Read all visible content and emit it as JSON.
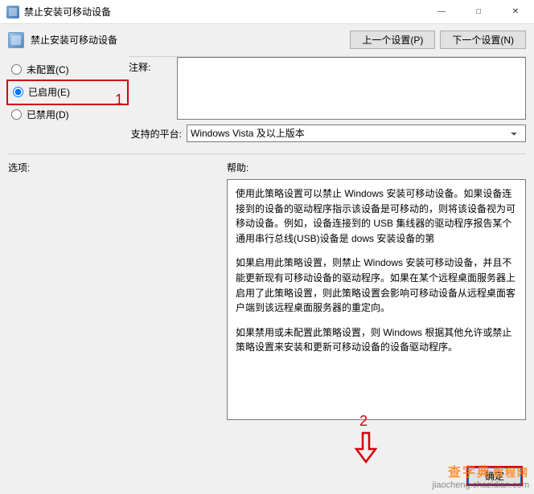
{
  "window": {
    "title": "禁止安装可移动设备",
    "minimize": "—",
    "maximize": "□",
    "close": "✕"
  },
  "header": {
    "policy_name": "禁止安装可移动设备",
    "prev_btn": "上一个设置(P)",
    "next_btn": "下一个设置(N)"
  },
  "state_radios": {
    "not_configured": "未配置(C)",
    "enabled": "已启用(E)",
    "disabled": "已禁用(D)",
    "selected": "enabled"
  },
  "annotations": {
    "one": "1",
    "two": "2"
  },
  "labels": {
    "comment": "注释:",
    "platform": "支持的平台:",
    "options": "选项:",
    "help": "帮助:"
  },
  "comment_value": "",
  "platform_value": "Windows Vista 及以上版本",
  "help_text": {
    "p1": "使用此策略设置可以禁止 Windows 安装可移动设备。如果设备连接到的设备的驱动程序指示该设备是可移动的，则将该设备视为可移动设备。例如，设备连接到的 USB 集线器的驱动程序报告某个通用串行总线(USB)设备是                                                                                      dows 安装设备的第",
    "p2": "如果启用此策略设置，则禁止 Windows 安装可移动设备，并且不能更新现有可移动设备的驱动程序。如果在某个远程桌面服务器上启用了此策略设置，则此策略设置会影响可移动设备从远程桌面客户端到该远程桌面服务器的重定向。",
    "p3": "如果禁用或未配置此策略设置，则 Windows 根据其他允许或禁止策略设置来安装和更新可移动设备的设备驱动程序。"
  },
  "buttons": {
    "ok": "确定"
  },
  "watermark": {
    "line1": "查字典",
    "line2": "jiaocheng.chazidian.com",
    "suffix": "教程网"
  }
}
